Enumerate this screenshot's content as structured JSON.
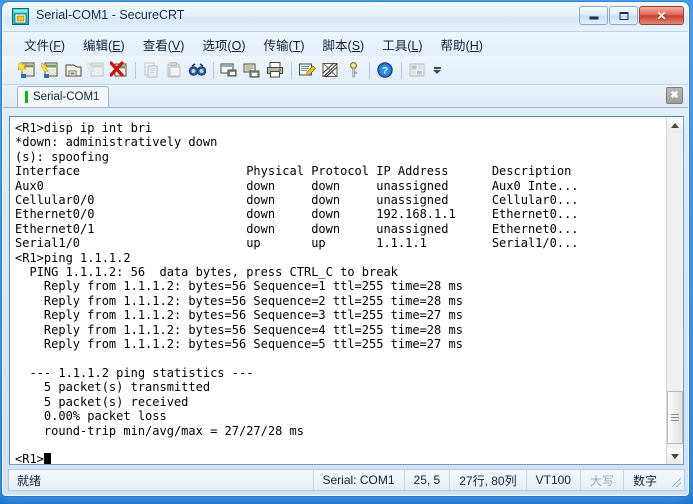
{
  "window": {
    "title": "Serial-COM1 - SecureCRT",
    "app_icon": "securecrt-icon",
    "minimize_label": "–",
    "maximize_label": "❐",
    "close_label": "✕"
  },
  "menubar": {
    "items": [
      {
        "name": "file",
        "text": "文件",
        "key": "F"
      },
      {
        "name": "edit",
        "text": "编辑",
        "key": "E"
      },
      {
        "name": "view",
        "text": "查看",
        "key": "V"
      },
      {
        "name": "options",
        "text": "选项",
        "key": "O"
      },
      {
        "name": "transfer",
        "text": "传输",
        "key": "T"
      },
      {
        "name": "script",
        "text": "脚本",
        "key": "S"
      },
      {
        "name": "tools",
        "text": "工具",
        "key": "L"
      },
      {
        "name": "help",
        "text": "帮助",
        "key": "H"
      }
    ]
  },
  "toolbar": {
    "buttons": [
      {
        "name": "new-session-icon",
        "enabled": true
      },
      {
        "name": "connect-icon",
        "enabled": true
      },
      {
        "name": "connect-local-icon",
        "enabled": true
      },
      {
        "name": "reconnect-icon",
        "enabled": false
      },
      {
        "name": "disconnect-icon",
        "enabled": true
      },
      {
        "name": "copy-icon",
        "enabled": false
      },
      {
        "name": "paste-icon",
        "enabled": false
      },
      {
        "name": "find-icon",
        "enabled": true
      },
      {
        "name": "print-screen-icon",
        "enabled": true
      },
      {
        "name": "log-session-icon",
        "enabled": true
      },
      {
        "name": "print-icon",
        "enabled": true
      },
      {
        "name": "session-options-icon",
        "enabled": true
      },
      {
        "name": "global-options-icon",
        "enabled": true
      },
      {
        "name": "key-icon",
        "enabled": true
      },
      {
        "name": "help-icon",
        "enabled": true
      },
      {
        "name": "keymap-editor-icon",
        "enabled": false
      }
    ],
    "overflow_label": "▼"
  },
  "tabs": {
    "items": [
      {
        "name": "tab-serial-com1",
        "label": "Serial-COM1",
        "active": true,
        "status_color": "#18b018"
      }
    ],
    "close_label": "✖"
  },
  "terminal": {
    "prompt": "<R1>",
    "cursor": "block",
    "lines": [
      "<R1>disp ip int bri",
      "*down: administratively down",
      "(s): spoofing",
      "Interface                       Physical Protocol IP Address      Description",
      "Aux0                            down     down     unassigned      Aux0 Inte...",
      "Cellular0/0                     down     down     unassigned      Cellular0...",
      "Ethernet0/0                     down     down     192.168.1.1     Ethernet0...",
      "Ethernet0/1                     down     down     unassigned      Ethernet0...",
      "Serial1/0                       up       up       1.1.1.1         Serial1/0...",
      "<R1>ping 1.1.1.2",
      "  PING 1.1.1.2: 56  data bytes, press CTRL_C to break",
      "    Reply from 1.1.1.2: bytes=56 Sequence=1 ttl=255 time=28 ms",
      "    Reply from 1.1.1.2: bytes=56 Sequence=2 ttl=255 time=28 ms",
      "    Reply from 1.1.1.2: bytes=56 Sequence=3 ttl=255 time=27 ms",
      "    Reply from 1.1.1.2: bytes=56 Sequence=4 ttl=255 time=28 ms",
      "    Reply from 1.1.1.2: bytes=56 Sequence=5 ttl=255 time=27 ms",
      "",
      "  --- 1.1.1.2 ping statistics ---",
      "    5 packet(s) transmitted",
      "    5 packet(s) received",
      "    0.00% packet loss",
      "    round-trip min/avg/max = 27/27/28 ms",
      ""
    ],
    "table": {
      "headers": [
        "Interface",
        "Physical",
        "Protocol",
        "IP Address",
        "Description"
      ],
      "rows": [
        [
          "Aux0",
          "down",
          "down",
          "unassigned",
          "Aux0 Inte..."
        ],
        [
          "Cellular0/0",
          "down",
          "down",
          "unassigned",
          "Cellular0..."
        ],
        [
          "Ethernet0/0",
          "down",
          "down",
          "192.168.1.1",
          "Ethernet0..."
        ],
        [
          "Ethernet0/1",
          "down",
          "down",
          "unassigned",
          "Ethernet0..."
        ],
        [
          "Serial1/0",
          "up",
          "up",
          "1.1.1.1",
          "Serial1/0..."
        ]
      ]
    },
    "ping": {
      "target": "1.1.1.2",
      "bytes": 56,
      "replies": [
        {
          "sequence": 1,
          "bytes": 56,
          "ttl": 255,
          "time_ms": 28
        },
        {
          "sequence": 2,
          "bytes": 56,
          "ttl": 255,
          "time_ms": 28
        },
        {
          "sequence": 3,
          "bytes": 56,
          "ttl": 255,
          "time_ms": 27
        },
        {
          "sequence": 4,
          "bytes": 56,
          "ttl": 255,
          "time_ms": 28
        },
        {
          "sequence": 5,
          "bytes": 56,
          "ttl": 255,
          "time_ms": 27
        }
      ],
      "transmitted": 5,
      "received": 5,
      "loss_percent": "0.00%",
      "round_trip": "27/27/28 ms"
    }
  },
  "scrollbar": {
    "up_arrow": "▲",
    "down_arrow": "▼"
  },
  "statusbar": {
    "ready": "就绪",
    "serial": "Serial: COM1",
    "cursor_pos": "25,  5",
    "dimensions": "27行, 80列",
    "emulation": "VT100",
    "caps": "大写",
    "num": "数字"
  },
  "colors": {
    "accent_blue": "#1a7fe0",
    "terminal_bg": "#ffffff",
    "terminal_fg": "#000000",
    "tab_status_green": "#18b018",
    "close_red": "#c63f30"
  }
}
